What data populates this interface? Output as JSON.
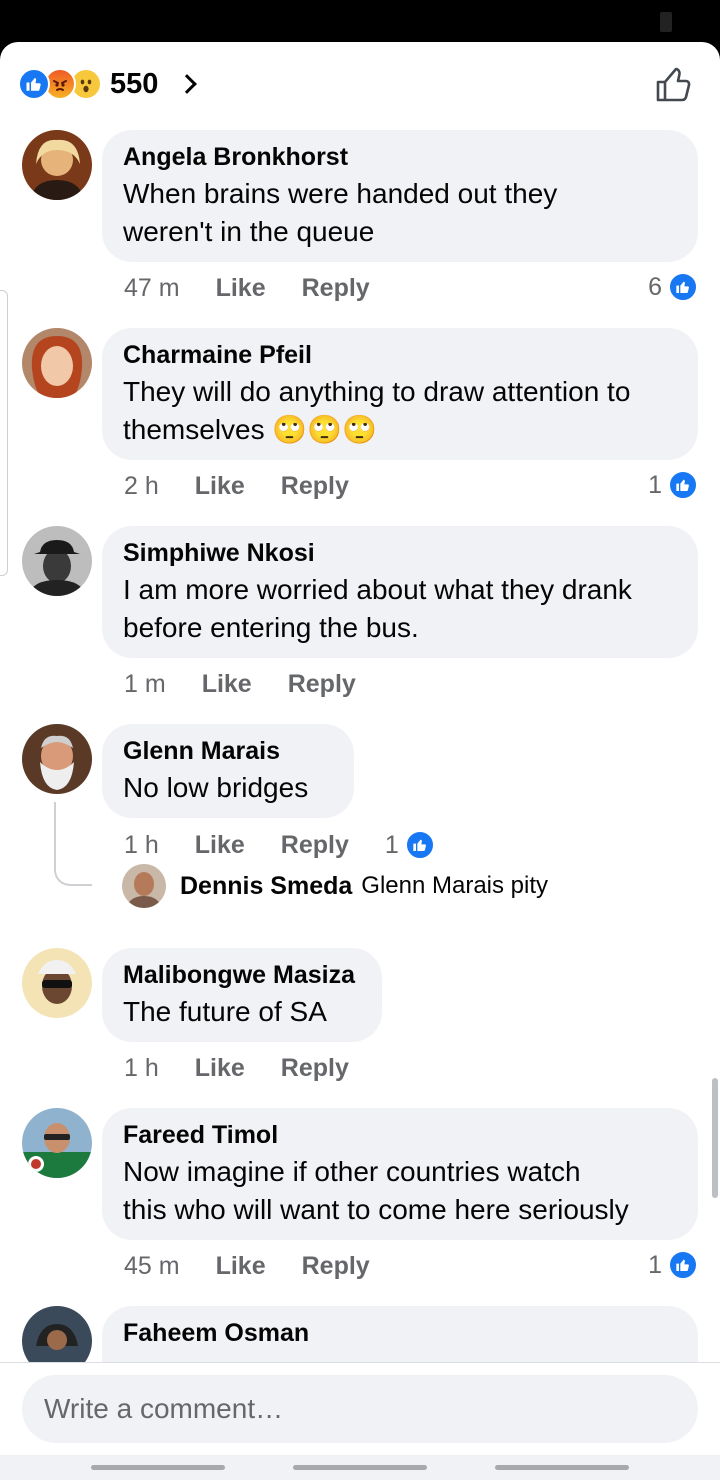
{
  "reactions": {
    "count": "550",
    "types": [
      "like-icon",
      "angry-icon",
      "wow-icon"
    ],
    "colors": {
      "like": "#1877f2",
      "angry": "#f05a24",
      "wow": "#f7c83c"
    }
  },
  "actions": {
    "like_label": "Like",
    "reply_label": "Reply"
  },
  "comments": [
    {
      "author": "Angela Bronkhorst",
      "text": "When brains were handed out they\nweren't in the queue",
      "time": "47 m",
      "likes": "6"
    },
    {
      "author": "Charmaine Pfeil",
      "text": "They will do anything to draw attention to\nthemselves 🙄🙄🙄",
      "time": "2 h",
      "likes": "1"
    },
    {
      "author": "Simphiwe Nkosi",
      "text": "I am more worried about what they drank\nbefore entering the bus.",
      "time": "1 m",
      "likes": ""
    },
    {
      "author": "Glenn Marais",
      "text": "No low bridges",
      "time": "1 h",
      "likes": "1",
      "reply": {
        "author": "Dennis Smeda",
        "text": "Glenn Marais pity"
      }
    },
    {
      "author": "Malibongwe Masiza",
      "text": "The future of SA",
      "time": "1 h",
      "likes": ""
    },
    {
      "author": "Fareed Timol",
      "text": "Now imagine if other countries watch\nthis who will want to come here seriously",
      "time": "45 m",
      "likes": "1"
    },
    {
      "author": "Faheem Osman",
      "text": "",
      "time": "",
      "likes": ""
    }
  ],
  "composer": {
    "placeholder": "Write a comment…"
  },
  "accent_color": "#1877f2"
}
